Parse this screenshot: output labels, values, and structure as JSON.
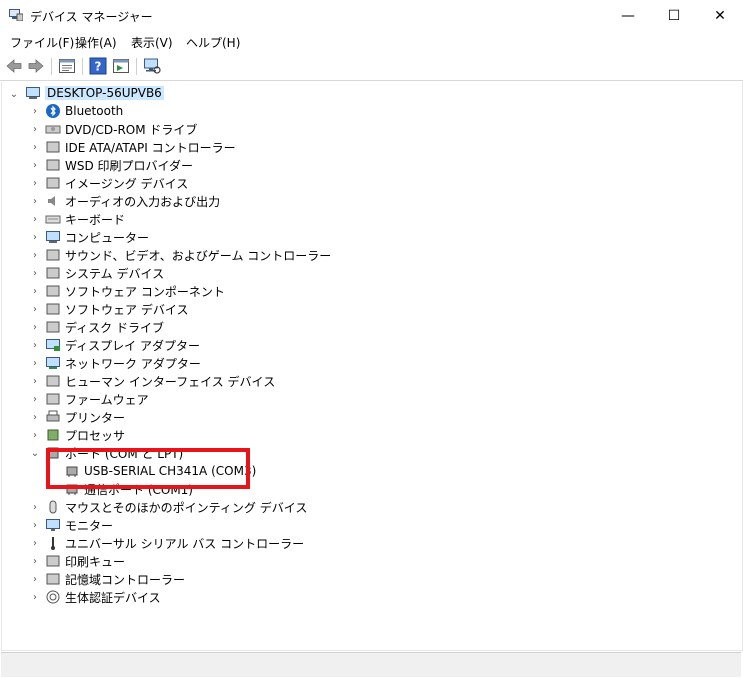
{
  "window": {
    "title": "デバイス マネージャー",
    "minimize_glyph": "—",
    "maximize_glyph": "☐",
    "close_glyph": "✕"
  },
  "menu": [
    {
      "label": "ファイル(F)"
    },
    {
      "label": "操作(A)"
    },
    {
      "label": "表示(V)"
    },
    {
      "label": "ヘルプ(H)"
    }
  ],
  "tree": {
    "root": {
      "label": "DESKTOP-56UPVB6",
      "expanded": true
    },
    "categories": [
      {
        "label": "Bluetooth",
        "icon": "bluetooth-icon"
      },
      {
        "label": "DVD/CD-ROM ドライブ",
        "icon": "dvd-drive-icon"
      },
      {
        "label": "IDE ATA/ATAPI コントローラー",
        "icon": "ide-controller-icon"
      },
      {
        "label": "WSD 印刷プロバイダー",
        "icon": "wsd-printer-icon"
      },
      {
        "label": "イメージング デバイス",
        "icon": "camera-icon"
      },
      {
        "label": "オーディオの入力および出力",
        "icon": "speaker-icon"
      },
      {
        "label": "キーボード",
        "icon": "keyboard-icon"
      },
      {
        "label": "コンピューター",
        "icon": "computer-icon"
      },
      {
        "label": "サウンド、ビデオ、およびゲーム コントローラー",
        "icon": "sound-icon"
      },
      {
        "label": "システム デバイス",
        "icon": "system-device-icon"
      },
      {
        "label": "ソフトウェア コンポーネント",
        "icon": "software-component-icon"
      },
      {
        "label": "ソフトウェア デバイス",
        "icon": "software-device-icon"
      },
      {
        "label": "ディスク ドライブ",
        "icon": "disk-drive-icon"
      },
      {
        "label": "ディスプレイ アダプター",
        "icon": "display-adapter-icon"
      },
      {
        "label": "ネットワーク アダプター",
        "icon": "network-adapter-icon"
      },
      {
        "label": "ヒューマン インターフェイス デバイス",
        "icon": "hid-icon"
      },
      {
        "label": "ファームウェア",
        "icon": "firmware-icon"
      },
      {
        "label": "プリンター",
        "icon": "printer-icon"
      },
      {
        "label": "プロセッサ",
        "icon": "processor-icon"
      },
      {
        "label": "ポート (COM と LPT)",
        "icon": "port-icon",
        "expanded": true,
        "children": [
          {
            "label": "USB-SERIAL CH341A (COM3)",
            "icon": "port-device-icon"
          },
          {
            "label": "通信ポート (COM1)",
            "icon": "port-device-icon"
          }
        ]
      },
      {
        "label": "マウスとそのほかのポインティング デバイス",
        "icon": "mouse-icon"
      },
      {
        "label": "モニター",
        "icon": "monitor-icon"
      },
      {
        "label": "ユニバーサル シリアル バス コントローラー",
        "icon": "usb-icon"
      },
      {
        "label": "印刷キュー",
        "icon": "print-queue-icon"
      },
      {
        "label": "記憶域コントローラー",
        "icon": "storage-controller-icon"
      },
      {
        "label": "生体認証デバイス",
        "icon": "biometric-icon"
      }
    ]
  },
  "colors": {
    "highlight_border": "#e8141a",
    "selection_bg": "#cce8ff",
    "bluetooth_blue": "#1a66c9"
  }
}
